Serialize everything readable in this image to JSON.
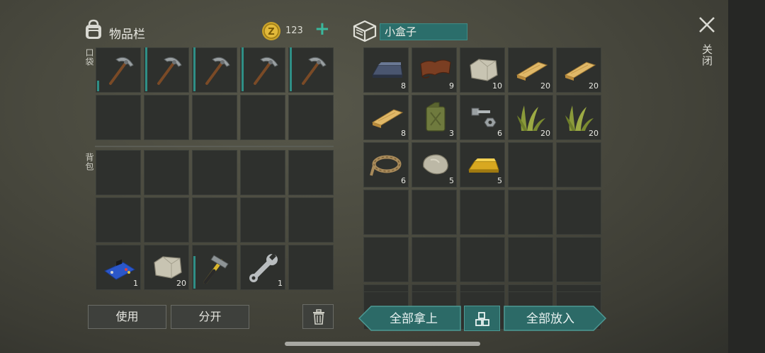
{
  "inventory": {
    "title": "物品栏",
    "coins": "123",
    "pocket_label": "口袋",
    "backpack_label": "背包"
  },
  "box": {
    "name": "小盒子"
  },
  "close_label": "关闭",
  "buttons": {
    "use": "使用",
    "split": "分开",
    "take_all": "全部拿上",
    "put_all": "全部放入"
  },
  "pocket_slots": [
    {
      "item": "pickaxe-icon",
      "qty": "",
      "durability": 0.25
    },
    {
      "item": "pickaxe-icon",
      "qty": "",
      "durability": 1.0
    },
    {
      "item": "pickaxe-icon",
      "qty": "",
      "durability": 1.0
    },
    {
      "item": "pickaxe-icon",
      "qty": "",
      "durability": 1.0
    },
    {
      "item": "pickaxe-icon",
      "qty": "",
      "durability": 1.0
    },
    {
      "item": "",
      "qty": ""
    },
    {
      "item": "",
      "qty": ""
    },
    {
      "item": "",
      "qty": ""
    },
    {
      "item": "",
      "qty": ""
    },
    {
      "item": "",
      "qty": ""
    }
  ],
  "backpack_slots": [
    {
      "item": "",
      "qty": ""
    },
    {
      "item": "",
      "qty": ""
    },
    {
      "item": "",
      "qty": ""
    },
    {
      "item": "",
      "qty": ""
    },
    {
      "item": "",
      "qty": ""
    },
    {
      "item": "",
      "qty": ""
    },
    {
      "item": "",
      "qty": ""
    },
    {
      "item": "",
      "qty": ""
    },
    {
      "item": "",
      "qty": ""
    },
    {
      "item": "",
      "qty": ""
    },
    {
      "item": "circuit-board-icon",
      "qty": "1"
    },
    {
      "item": "stone-block-icon",
      "qty": "20"
    },
    {
      "item": "hammer-icon",
      "qty": "",
      "durability": 0.75
    },
    {
      "item": "wrench-icon",
      "qty": "1"
    },
    {
      "item": "",
      "qty": ""
    }
  ],
  "box_slots": [
    {
      "item": "metal-ingot-icon",
      "qty": "8"
    },
    {
      "item": "leather-icon",
      "qty": "9"
    },
    {
      "item": "stone-block-icon",
      "qty": "10"
    },
    {
      "item": "wood-plank-icon",
      "qty": "20"
    },
    {
      "item": "wood-plank-icon",
      "qty": "20"
    },
    {
      "item": "wood-plank-icon",
      "qty": "8"
    },
    {
      "item": "fuel-canister-icon",
      "qty": "3"
    },
    {
      "item": "bolt-nut-icon",
      "qty": "6"
    },
    {
      "item": "plant-fiber-icon",
      "qty": "20"
    },
    {
      "item": "plant-fiber-icon",
      "qty": "20"
    },
    {
      "item": "rope-icon",
      "qty": "6"
    },
    {
      "item": "stone-icon",
      "qty": "5"
    },
    {
      "item": "gold-ingot-icon",
      "qty": "5"
    },
    {
      "item": "",
      "qty": ""
    },
    {
      "item": "",
      "qty": ""
    },
    {
      "item": "",
      "qty": ""
    },
    {
      "item": "",
      "qty": ""
    },
    {
      "item": "",
      "qty": ""
    },
    {
      "item": "",
      "qty": ""
    },
    {
      "item": "",
      "qty": ""
    },
    {
      "item": "",
      "qty": ""
    },
    {
      "item": "",
      "qty": ""
    },
    {
      "item": "",
      "qty": ""
    },
    {
      "item": "",
      "qty": ""
    },
    {
      "item": "",
      "qty": ""
    },
    {
      "item": "",
      "qty": ""
    },
    {
      "item": "",
      "qty": ""
    },
    {
      "item": "",
      "qty": ""
    },
    {
      "item": "",
      "qty": ""
    },
    {
      "item": "",
      "qty": ""
    }
  ]
}
